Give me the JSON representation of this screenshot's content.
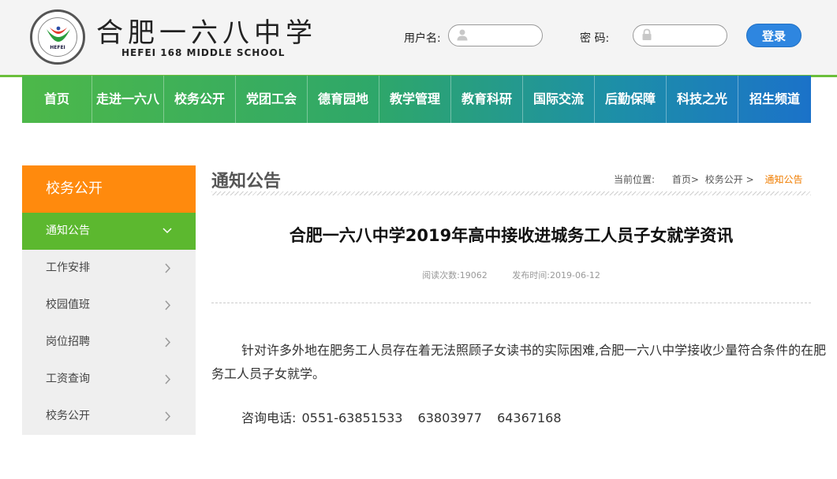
{
  "header": {
    "school_name_cn": "合肥一六八中学",
    "school_name_en": "HEFEI 168 MIDDLE SCHOOL",
    "logo_text": "HEFEI",
    "username_label": "用户名:",
    "password_label": "密 码:",
    "username_value": "",
    "password_value": "",
    "login_button": "登录",
    "user_icon": "user-icon",
    "lock_icon": "lock-icon"
  },
  "nav": {
    "items": [
      "首页",
      "走进一六八",
      "校务公开",
      "党团工会",
      "德育园地",
      "教学管理",
      "教育科研",
      "国际交流",
      "后勤保障",
      "科技之光",
      "招生频道"
    ]
  },
  "sidebar": {
    "title": "校务公开",
    "items": [
      {
        "label": "通知公告",
        "active": true
      },
      {
        "label": "工作安排",
        "active": false
      },
      {
        "label": "校园值班",
        "active": false
      },
      {
        "label": "岗位招聘",
        "active": false
      },
      {
        "label": "工资查询",
        "active": false
      },
      {
        "label": "校务公开",
        "active": false
      }
    ]
  },
  "content": {
    "section_title": "通知公告",
    "breadcrumb": {
      "prefix": "当前位置:",
      "items": [
        "首页>",
        "校务公开 >",
        "通知公告"
      ]
    },
    "article_title": "合肥一六八中学2019年高中接收进城务工人员子女就学资讯",
    "meta": {
      "views": "阅读次数:19062",
      "date": "发布时间:2019-06-12"
    },
    "paragraph": "针对许多外地在肥务工人员存在着无法照顾子女读书的实际困难,合肥一六八中学接收少量符合条件的在肥务工人员子女就学。",
    "contact": {
      "label": "咨询电话:",
      "phones": [
        "0551-63851533",
        "63803977",
        "64367168"
      ]
    }
  },
  "colors": {
    "nav_green": "#4db849",
    "nav_blue": "#1b72c9",
    "sidebar_header": "#ff8a0d",
    "sidebar_active": "#5cb82f",
    "login_button": "#2e86e0",
    "breadcrumb_active": "#f07d00"
  }
}
